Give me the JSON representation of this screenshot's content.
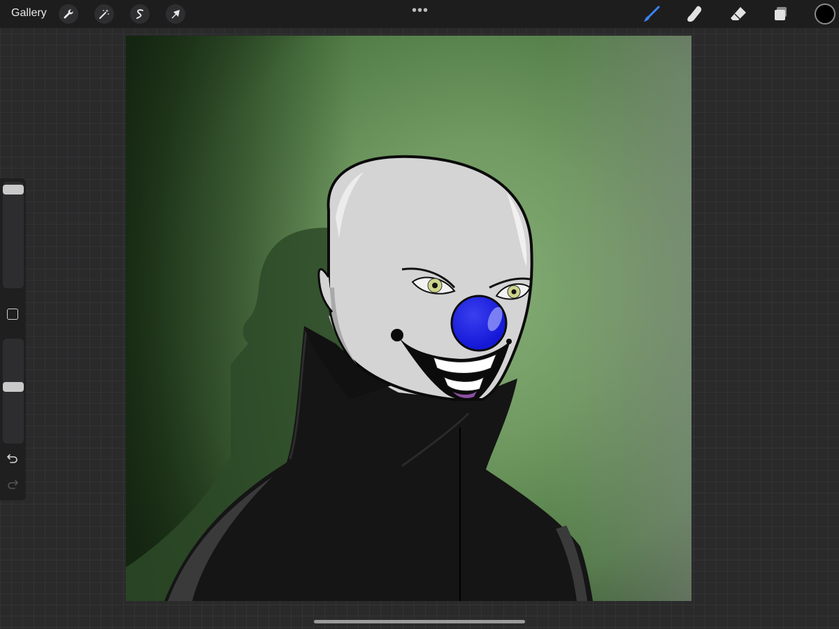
{
  "topbar": {
    "gallery_label": "Gallery",
    "left_tools": [
      {
        "name": "actions",
        "icon": "wrench-icon"
      },
      {
        "name": "adjustments",
        "icon": "magic-wand-icon"
      },
      {
        "name": "selection",
        "icon": "selection-s-icon"
      },
      {
        "name": "transform",
        "icon": "arrow-cursor-icon"
      }
    ],
    "more_label": "•••",
    "right_tools": [
      {
        "name": "brush",
        "icon": "brush-icon",
        "active": true
      },
      {
        "name": "smudge",
        "icon": "smudge-finger-icon",
        "active": false
      },
      {
        "name": "eraser",
        "icon": "eraser-icon",
        "active": false
      },
      {
        "name": "layers",
        "icon": "layers-icon",
        "active": false
      }
    ],
    "current_color": "#000000",
    "active_tool_color": "#3b82f6"
  },
  "sidebar": {
    "brush_size_level": 0.0,
    "opacity_level": 0.46,
    "icons": [
      "modify-square-icon",
      "undo-icon",
      "redo-icon"
    ]
  },
  "canvas": {
    "background_colors": [
      "#1e3418",
      "#6f9a63",
      "#8aa88a"
    ],
    "figure": {
      "skin": "#d4d4d4",
      "nose": "#1b1ee0",
      "coat": "#151515",
      "eyes": "#cdd48a",
      "tongue": "#8c4fa0"
    }
  }
}
